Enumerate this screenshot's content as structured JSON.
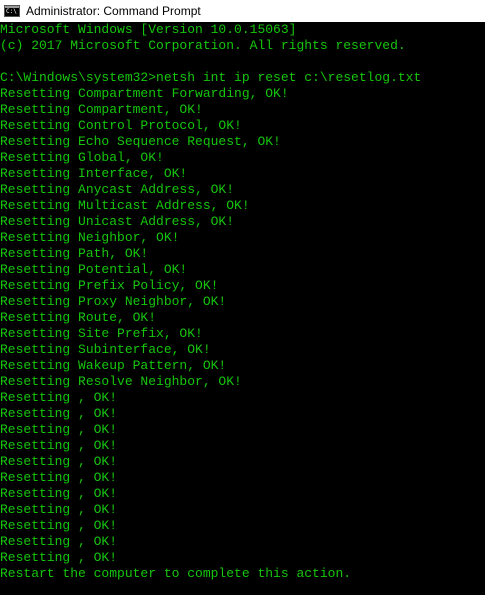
{
  "window": {
    "title": "Administrator: Command Prompt",
    "icon": "command-prompt-icon",
    "icon_text": "C:\\"
  },
  "colors": {
    "console_background": "#000000",
    "console_text": "#16c60c",
    "titlebar_background": "#ffffff"
  },
  "console": {
    "lines": [
      "Microsoft Windows [Version 10.0.15063]",
      "(c) 2017 Microsoft Corporation. All rights reserved.",
      "",
      "C:\\Windows\\system32>netsh int ip reset c:\\resetlog.txt",
      "Resetting Compartment Forwarding, OK!",
      "Resetting Compartment, OK!",
      "Resetting Control Protocol, OK!",
      "Resetting Echo Sequence Request, OK!",
      "Resetting Global, OK!",
      "Resetting Interface, OK!",
      "Resetting Anycast Address, OK!",
      "Resetting Multicast Address, OK!",
      "Resetting Unicast Address, OK!",
      "Resetting Neighbor, OK!",
      "Resetting Path, OK!",
      "Resetting Potential, OK!",
      "Resetting Prefix Policy, OK!",
      "Resetting Proxy Neighbor, OK!",
      "Resetting Route, OK!",
      "Resetting Site Prefix, OK!",
      "Resetting Subinterface, OK!",
      "Resetting Wakeup Pattern, OK!",
      "Resetting Resolve Neighbor, OK!",
      "Resetting , OK!",
      "Resetting , OK!",
      "Resetting , OK!",
      "Resetting , OK!",
      "Resetting , OK!",
      "Resetting , OK!",
      "Resetting , OK!",
      "Resetting , OK!",
      "Resetting , OK!",
      "Resetting , OK!",
      "Resetting , OK!",
      "Restart the computer to complete this action."
    ]
  }
}
